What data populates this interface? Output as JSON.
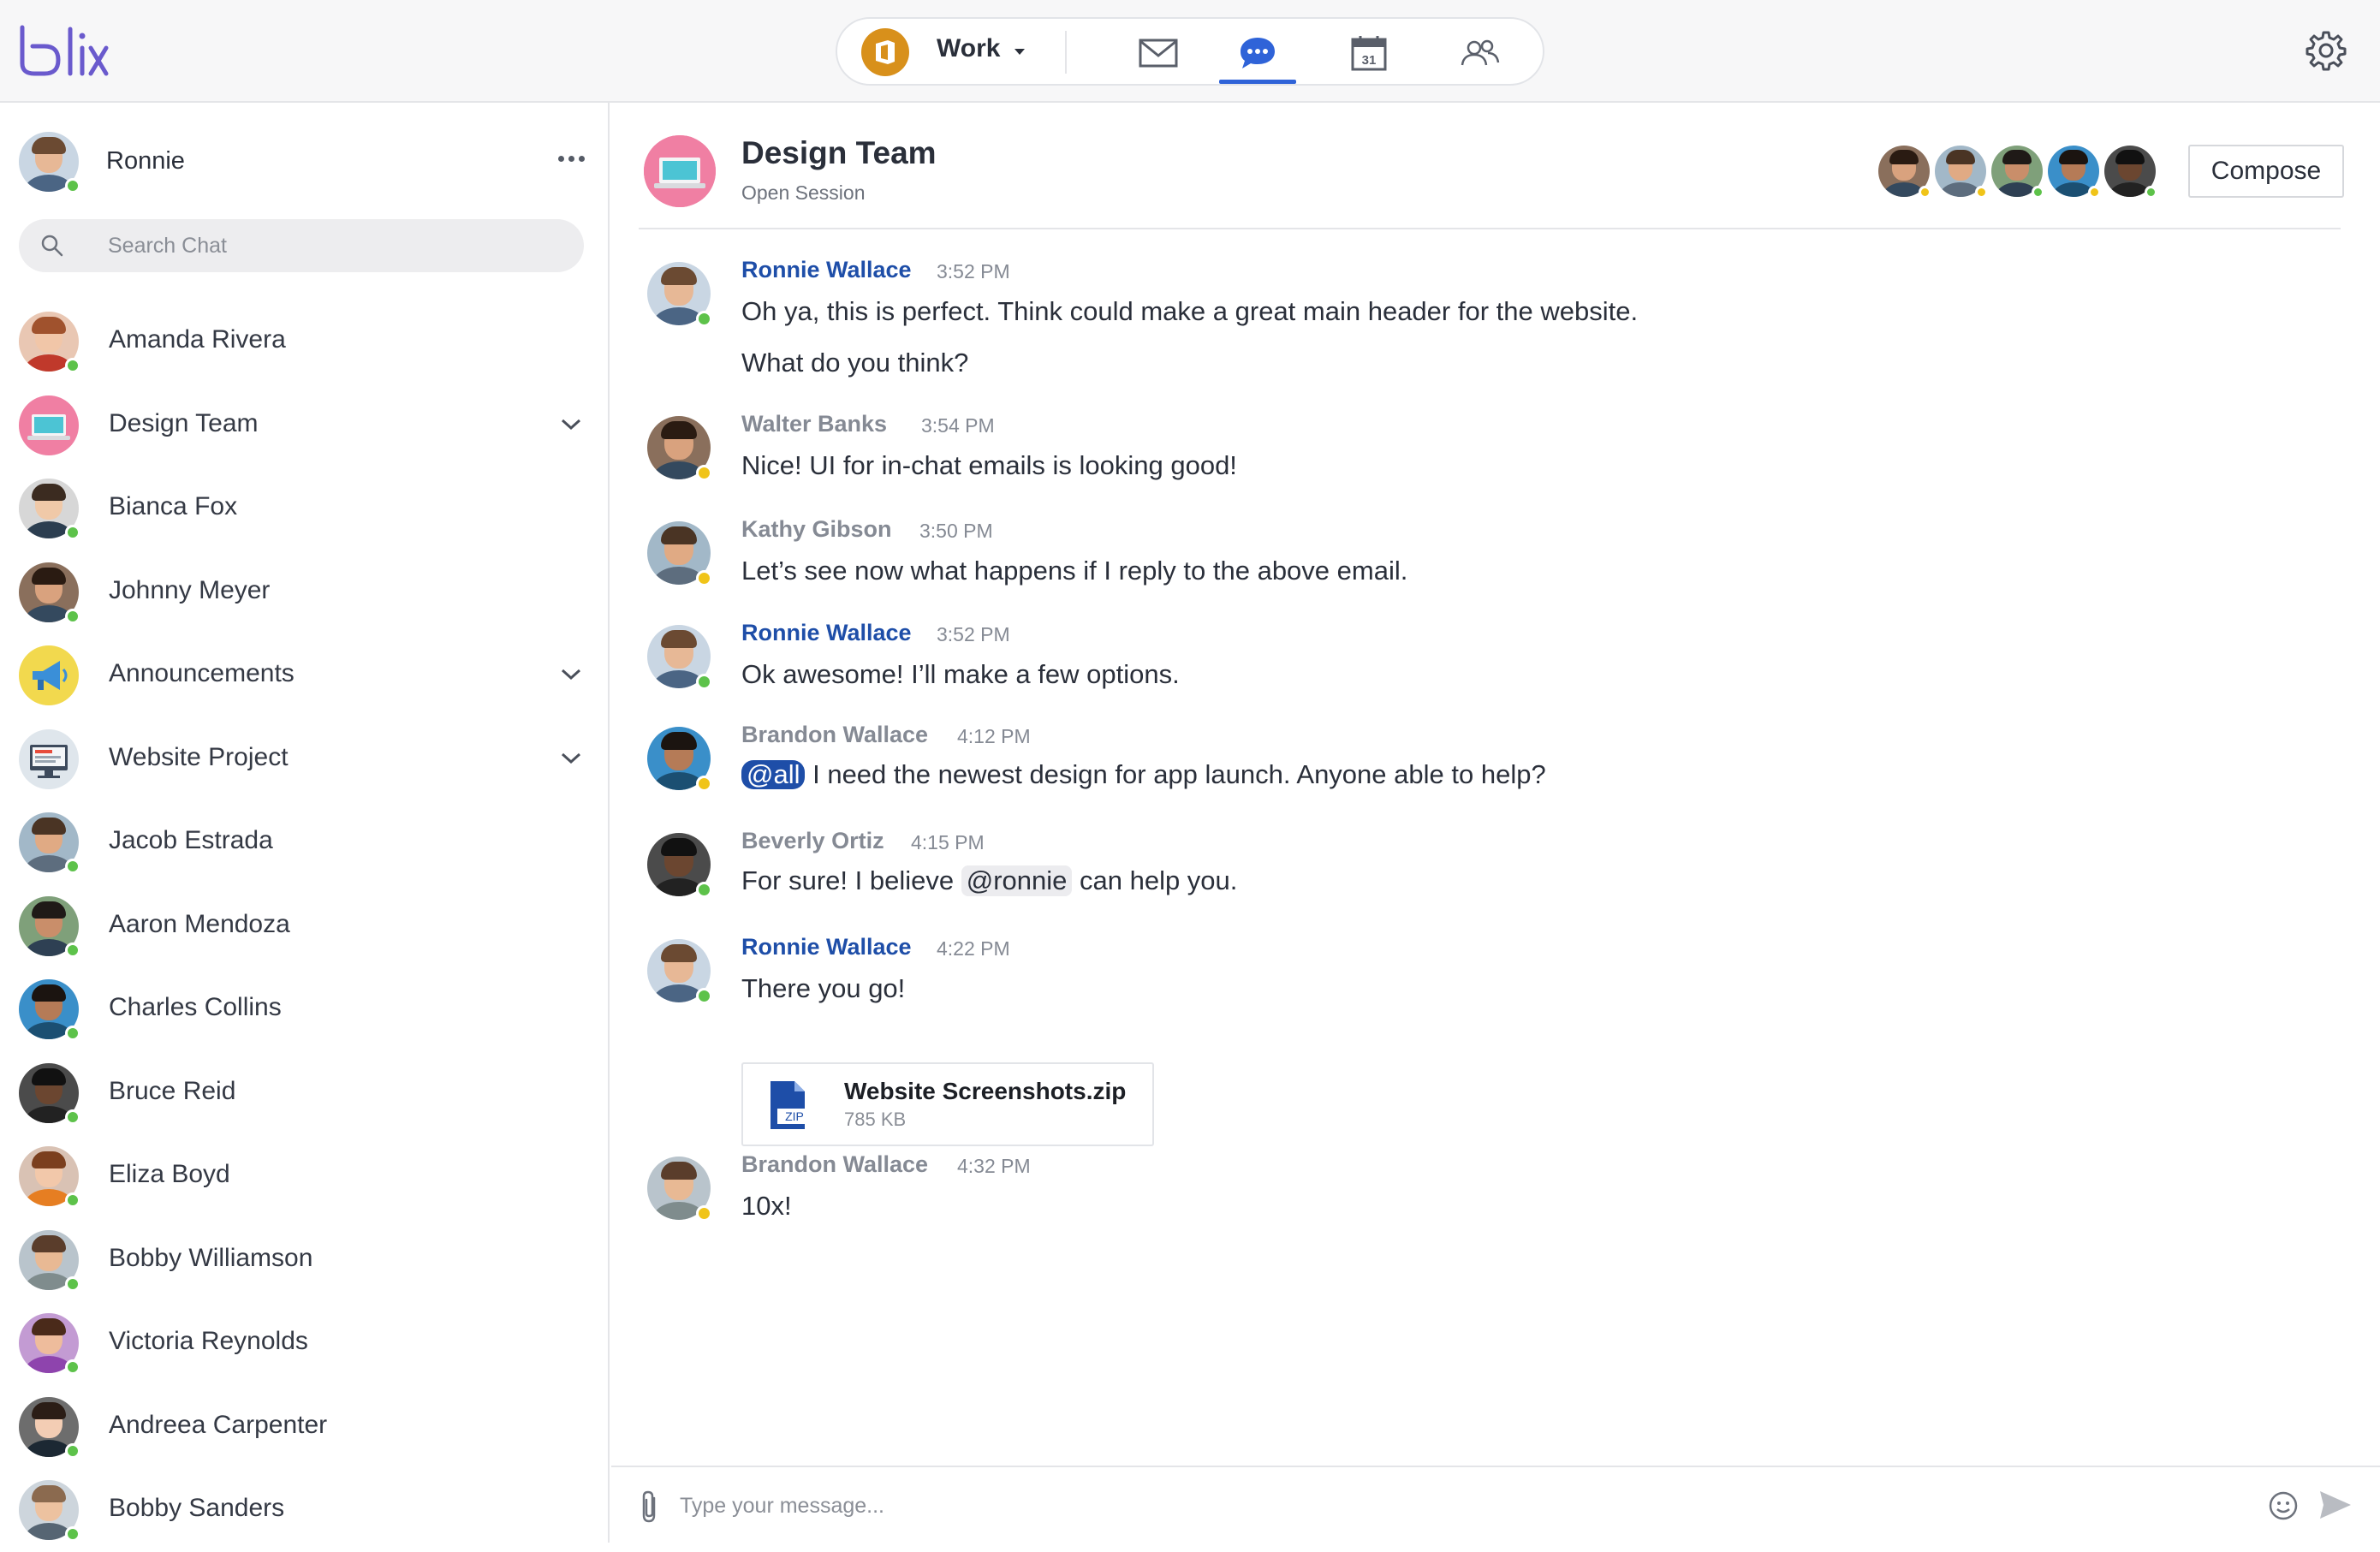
{
  "app": {
    "logo_text": "blix",
    "account": {
      "name": "Work",
      "icon": "office-icon",
      "icon_color": "#d8901b"
    },
    "nav": [
      {
        "id": "mail",
        "icon": "mail-icon"
      },
      {
        "id": "chat",
        "icon": "chat-icon",
        "active": true
      },
      {
        "id": "calendar",
        "icon": "calendar-icon",
        "date": "31"
      },
      {
        "id": "contacts",
        "icon": "contacts-icon"
      }
    ],
    "accent_color": "#2f63d8"
  },
  "sidebar": {
    "me": {
      "name": "Ronnie",
      "status": "online"
    },
    "search": {
      "placeholder": "Search Chat"
    },
    "chats": [
      {
        "name": "Amanda Rivera",
        "status": "online",
        "type": "person"
      },
      {
        "name": "Design Team",
        "type": "group",
        "expandable": true
      },
      {
        "name": "Bianca Fox",
        "status": "online",
        "type": "person"
      },
      {
        "name": "Johnny Meyer",
        "status": "online",
        "type": "person"
      },
      {
        "name": "Announcements",
        "type": "group",
        "expandable": true
      },
      {
        "name": "Website Project",
        "type": "group",
        "expandable": true
      },
      {
        "name": "Jacob Estrada",
        "status": "online",
        "type": "person"
      },
      {
        "name": "Aaron Mendoza",
        "status": "online",
        "type": "person"
      },
      {
        "name": "Charles Collins",
        "status": "online",
        "type": "person"
      },
      {
        "name": "Bruce Reid",
        "status": "online",
        "type": "person"
      },
      {
        "name": "Eliza Boyd",
        "status": "online",
        "type": "person"
      },
      {
        "name": "Bobby Williamson",
        "status": "online",
        "type": "person"
      },
      {
        "name": "Victoria Reynolds",
        "status": "online",
        "type": "person"
      },
      {
        "name": "Andreea Carpenter",
        "status": "online",
        "type": "person"
      },
      {
        "name": "Bobby Sanders",
        "status": "online",
        "type": "person"
      }
    ]
  },
  "conversation": {
    "title": "Design Team",
    "subtitle": "Open Session",
    "members": [
      {
        "status": "away"
      },
      {
        "status": "away"
      },
      {
        "status": "online"
      },
      {
        "status": "away"
      },
      {
        "status": "online"
      }
    ],
    "compose_label": "Compose",
    "messages": [
      {
        "sender": "Ronnie Wallace",
        "self": true,
        "time": "3:52 PM",
        "status": "online",
        "lines": [
          "Oh ya, this is perfect. Think could make a great main header for the website.",
          "What do you think?"
        ]
      },
      {
        "sender": "Walter Banks",
        "self": false,
        "time": "3:54 PM",
        "status": "away",
        "lines": [
          "Nice! UI for in-chat emails is looking good!"
        ]
      },
      {
        "sender": "Kathy Gibson",
        "self": false,
        "time": "3:50 PM",
        "status": "away",
        "lines": [
          "Let’s see now what happens if I reply to the above email."
        ]
      },
      {
        "sender": "Ronnie Wallace",
        "self": true,
        "time": "3:52 PM",
        "status": "online",
        "lines": [
          "Ok awesome! I’ll make a few options."
        ]
      },
      {
        "sender": "Brandon Wallace",
        "self": false,
        "time": "4:12 PM",
        "status": "away",
        "mention": "@all",
        "text_after_mention": " I need the newest design for app launch. Anyone able to help?"
      },
      {
        "sender": "Beverly Ortiz",
        "self": false,
        "time": "4:15 PM",
        "status": "online",
        "text_before_mention": "For sure! I believe ",
        "mention": "@ronnie",
        "text_after_mention": " can help you."
      },
      {
        "sender": "Ronnie Wallace",
        "self": true,
        "time": "4:22 PM",
        "status": "online",
        "lines": [
          "There you go!"
        ],
        "attachment": {
          "name": "Website Screenshots.zip",
          "size": "785 KB",
          "type_label": "ZIP"
        }
      },
      {
        "sender": "Brandon Wallace",
        "self": false,
        "time": "4:32 PM",
        "status": "away",
        "lines": [
          "10x!"
        ]
      }
    ]
  },
  "composer": {
    "placeholder": "Type your message..."
  }
}
